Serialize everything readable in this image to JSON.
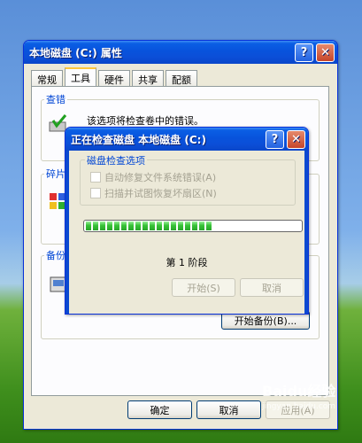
{
  "properties_window": {
    "title": "本地磁盘 (C:) 属性",
    "tabs": [
      {
        "label": "常规",
        "active": false
      },
      {
        "label": "工具",
        "active": true
      },
      {
        "label": "硬件",
        "active": false
      },
      {
        "label": "共享",
        "active": false
      },
      {
        "label": "配额",
        "active": false
      }
    ],
    "error_check_group": {
      "label": "查错",
      "description": "该选项将检查卷中的错误。"
    },
    "defrag_group": {
      "label": "碎片"
    },
    "backup_group": {
      "label": "备份",
      "button_label": "开始备份(B)..."
    },
    "ok_label": "确定",
    "cancel_label": "取消",
    "apply_label": "应用(A)"
  },
  "check_dialog": {
    "title": "正在检查磁盘 本地磁盘 (C:)",
    "options_group_label": "磁盘检查选项",
    "option_fix_label": "自动修复文件系统错误(A)",
    "option_scan_label": "扫描并试图恢复坏扇区(N)",
    "progress_percent": 60,
    "stage_text": "第 1 阶段",
    "start_label": "开始(S)",
    "cancel_label": "取消"
  },
  "watermark": "Baidu经验",
  "watermark_url": "jingyan.baidu.com",
  "colors": {
    "title_bar": "#0a5ee4",
    "progress": "#37c237",
    "group_label": "#0046d5"
  }
}
